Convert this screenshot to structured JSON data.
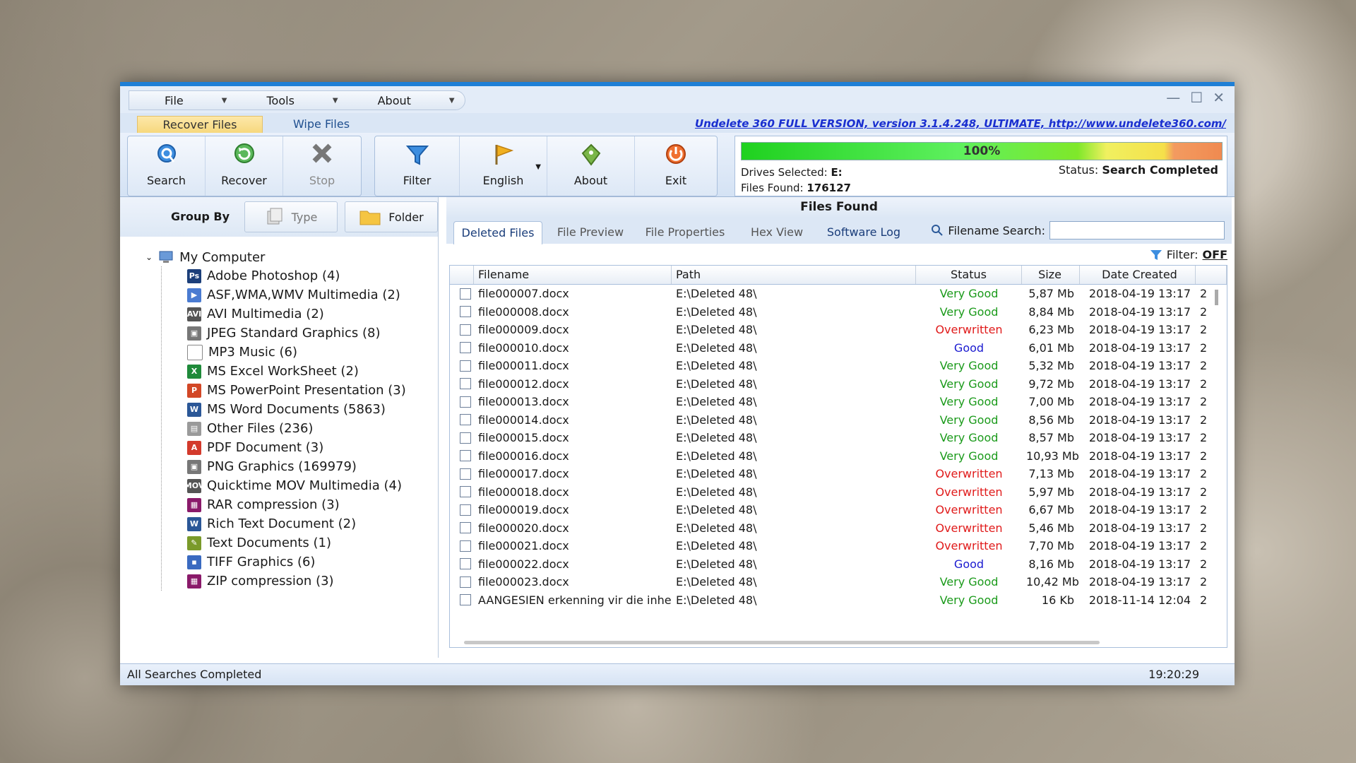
{
  "menu": {
    "items": [
      {
        "label": "File"
      },
      {
        "label": "Tools"
      },
      {
        "label": "About"
      }
    ]
  },
  "main_tabs": [
    {
      "label": "Recover Files"
    },
    {
      "label": "Wipe Files"
    }
  ],
  "version_link": "Undelete 360 FULL VERSION, version 3.1.4.248, ULTIMATE, http://www.undelete360.com/",
  "toolbar": {
    "search": "Search",
    "recover": "Recover",
    "stop": "Stop",
    "filter": "Filter",
    "english": "English",
    "about": "About",
    "exit": "Exit"
  },
  "progress": {
    "percent_label": "100%",
    "fraction": 1.0,
    "drives_label": "Drives Selected:",
    "drives_value": "E:",
    "files_label": "Files Found:",
    "files_value": "176127",
    "status_label": "Status:",
    "status_value": "Search Completed"
  },
  "group_by": {
    "label": "Group By",
    "type": "Type",
    "folder": "Folder"
  },
  "tree": {
    "root": "My Computer",
    "items": [
      {
        "label": "Adobe Photoshop (4)",
        "icon": "photoshop-icon",
        "color": "#1c3f7a",
        "glyph": "Ps"
      },
      {
        "label": "ASF,WMA,WMV Multimedia (2)",
        "icon": "media-icon",
        "color": "#4a7bd1",
        "glyph": "▶"
      },
      {
        "label": "AVI Multimedia (2)",
        "icon": "avi-icon",
        "color": "#555555",
        "glyph": "AVI"
      },
      {
        "label": "JPEG Standard Graphics (8)",
        "icon": "jpeg-icon",
        "color": "#777777",
        "glyph": "▣"
      },
      {
        "label": "MP3 Music (6)",
        "icon": "mp3-icon",
        "color": "#ffffff",
        "glyph": ""
      },
      {
        "label": "MS Excel WorkSheet (2)",
        "icon": "excel-icon",
        "color": "#1f8a3a",
        "glyph": "X"
      },
      {
        "label": "MS PowerPoint Presentation (3)",
        "icon": "powerpoint-icon",
        "color": "#d24726",
        "glyph": "P"
      },
      {
        "label": "MS Word Documents (5863)",
        "icon": "word-icon",
        "color": "#2b5797",
        "glyph": "W"
      },
      {
        "label": "Other Files (236)",
        "icon": "file-icon",
        "color": "#9a9a9a",
        "glyph": "▤"
      },
      {
        "label": "PDF Document (3)",
        "icon": "pdf-icon",
        "color": "#d33a2c",
        "glyph": "A"
      },
      {
        "label": "PNG Graphics (169979)",
        "icon": "png-icon",
        "color": "#777777",
        "glyph": "▣"
      },
      {
        "label": "Quicktime MOV Multimedia (4)",
        "icon": "mov-icon",
        "color": "#555555",
        "glyph": "MOV"
      },
      {
        "label": "RAR compression (3)",
        "icon": "rar-icon",
        "color": "#8a1a6a",
        "glyph": "▦"
      },
      {
        "label": "Rich Text Document (2)",
        "icon": "rtf-icon",
        "color": "#2b5797",
        "glyph": "W"
      },
      {
        "label": "Text Documents (1)",
        "icon": "text-icon",
        "color": "#7a9a2a",
        "glyph": "✎"
      },
      {
        "label": "TIFF Graphics (6)",
        "icon": "tiff-icon",
        "color": "#3a6ac0",
        "glyph": "▪"
      },
      {
        "label": "ZIP compression (3)",
        "icon": "zip-icon",
        "color": "#8a1a6a",
        "glyph": "▦"
      }
    ]
  },
  "files_found_title": "Files Found",
  "sub_tabs": [
    {
      "label": "Deleted Files"
    },
    {
      "label": "File Preview"
    },
    {
      "label": "File Properties"
    },
    {
      "label": "Hex View"
    },
    {
      "label": "Software Log"
    }
  ],
  "filename_search_label": "Filename Search:",
  "filter_label": "Filter:",
  "filter_value": "OFF",
  "columns": [
    "Filename",
    "Path",
    "Status",
    "Size",
    "Date Created"
  ],
  "rows": [
    {
      "name": "file000007.docx",
      "path": "E:\\Deleted 48\\",
      "status": "Very Good",
      "size": "5,87 Mb",
      "date": "2018-04-19 13:17",
      "extra": "2"
    },
    {
      "name": "file000008.docx",
      "path": "E:\\Deleted 48\\",
      "status": "Very Good",
      "size": "8,84 Mb",
      "date": "2018-04-19 13:17",
      "extra": "2"
    },
    {
      "name": "file000009.docx",
      "path": "E:\\Deleted 48\\",
      "status": "Overwritten",
      "size": "6,23 Mb",
      "date": "2018-04-19 13:17",
      "extra": "2"
    },
    {
      "name": "file000010.docx",
      "path": "E:\\Deleted 48\\",
      "status": "Good",
      "size": "6,01 Mb",
      "date": "2018-04-19 13:17",
      "extra": "2"
    },
    {
      "name": "file000011.docx",
      "path": "E:\\Deleted 48\\",
      "status": "Very Good",
      "size": "5,32 Mb",
      "date": "2018-04-19 13:17",
      "extra": "2"
    },
    {
      "name": "file000012.docx",
      "path": "E:\\Deleted 48\\",
      "status": "Very Good",
      "size": "9,72 Mb",
      "date": "2018-04-19 13:17",
      "extra": "2"
    },
    {
      "name": "file000013.docx",
      "path": "E:\\Deleted 48\\",
      "status": "Very Good",
      "size": "7,00 Mb",
      "date": "2018-04-19 13:17",
      "extra": "2"
    },
    {
      "name": "file000014.docx",
      "path": "E:\\Deleted 48\\",
      "status": "Very Good",
      "size": "8,56 Mb",
      "date": "2018-04-19 13:17",
      "extra": "2"
    },
    {
      "name": "file000015.docx",
      "path": "E:\\Deleted 48\\",
      "status": "Very Good",
      "size": "8,57 Mb",
      "date": "2018-04-19 13:17",
      "extra": "2"
    },
    {
      "name": "file000016.docx",
      "path": "E:\\Deleted 48\\",
      "status": "Very Good",
      "size": "10,93 Mb",
      "date": "2018-04-19 13:17",
      "extra": "2"
    },
    {
      "name": "file000017.docx",
      "path": "E:\\Deleted 48\\",
      "status": "Overwritten",
      "size": "7,13 Mb",
      "date": "2018-04-19 13:17",
      "extra": "2"
    },
    {
      "name": "file000018.docx",
      "path": "E:\\Deleted 48\\",
      "status": "Overwritten",
      "size": "5,97 Mb",
      "date": "2018-04-19 13:17",
      "extra": "2"
    },
    {
      "name": "file000019.docx",
      "path": "E:\\Deleted 48\\",
      "status": "Overwritten",
      "size": "6,67 Mb",
      "date": "2018-04-19 13:17",
      "extra": "2"
    },
    {
      "name": "file000020.docx",
      "path": "E:\\Deleted 48\\",
      "status": "Overwritten",
      "size": "5,46 Mb",
      "date": "2018-04-19 13:17",
      "extra": "2"
    },
    {
      "name": "file000021.docx",
      "path": "E:\\Deleted 48\\",
      "status": "Overwritten",
      "size": "7,70 Mb",
      "date": "2018-04-19 13:17",
      "extra": "2"
    },
    {
      "name": "file000022.docx",
      "path": "E:\\Deleted 48\\",
      "status": "Good",
      "size": "8,16 Mb",
      "date": "2018-04-19 13:17",
      "extra": "2"
    },
    {
      "name": "file000023.docx",
      "path": "E:\\Deleted 48\\",
      "status": "Very Good",
      "size": "10,42 Mb",
      "date": "2018-04-19 13:17",
      "extra": "2"
    },
    {
      "name": "AANGESIEN erkenning vir die inher…",
      "path": "E:\\Deleted 48\\",
      "status": "Very Good",
      "size": "16 Kb",
      "date": "2018-11-14 12:04",
      "extra": "2"
    }
  ],
  "statusbar": {
    "left": "All Searches Completed",
    "time": "19:20:29"
  }
}
